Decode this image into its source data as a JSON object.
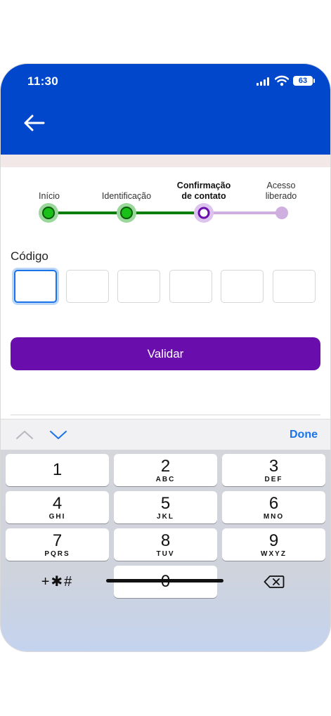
{
  "status": {
    "time": "11:30",
    "battery": "63"
  },
  "colors": {
    "header": "#0047cc",
    "accent": "#6a0dad",
    "done_steps": "#0a7e0a"
  },
  "stepper": {
    "steps": [
      {
        "label": "Início",
        "state": "done"
      },
      {
        "label": "Identificação",
        "state": "done"
      },
      {
        "label": "Confirmação de contato",
        "label_line1": "Confirmação",
        "label_line2": "de contato",
        "state": "current"
      },
      {
        "label": "Acesso liberado",
        "label_line1": "Acesso",
        "label_line2": "liberado",
        "state": "pending"
      }
    ]
  },
  "form": {
    "code_label": "Código",
    "code_length": 6,
    "submit_label": "Validar"
  },
  "toolbar": {
    "done_label": "Done"
  },
  "keypad": {
    "keys": [
      {
        "num": "1",
        "letters": ""
      },
      {
        "num": "2",
        "letters": "ABC"
      },
      {
        "num": "3",
        "letters": "DEF"
      },
      {
        "num": "4",
        "letters": "GHI"
      },
      {
        "num": "5",
        "letters": "JKL"
      },
      {
        "num": "6",
        "letters": "MNO"
      },
      {
        "num": "7",
        "letters": "PQRS"
      },
      {
        "num": "8",
        "letters": "TUV"
      },
      {
        "num": "9",
        "letters": "WXYZ"
      }
    ],
    "symbols": "+✱#",
    "zero": "0"
  }
}
